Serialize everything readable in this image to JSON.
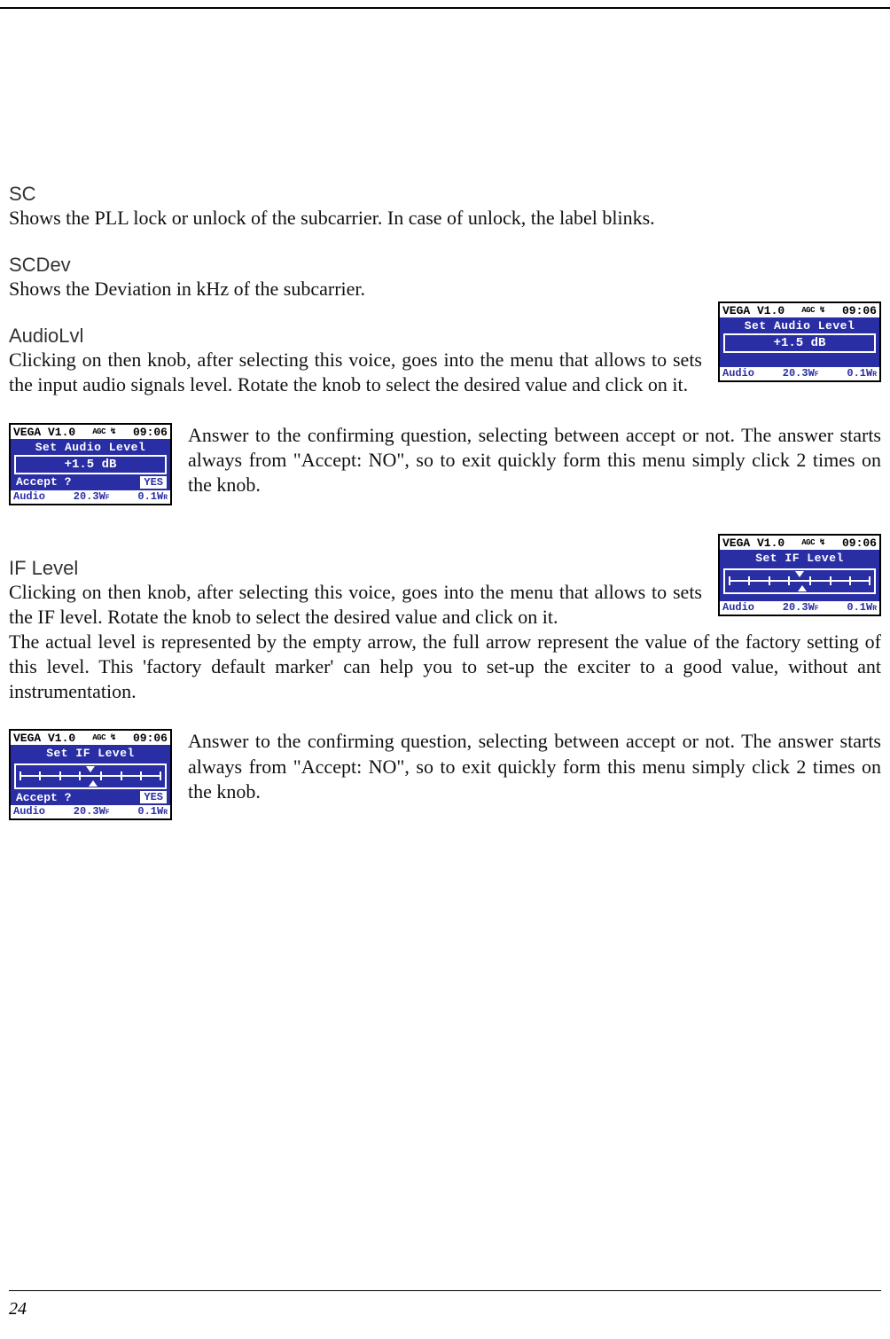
{
  "sections": {
    "sc": {
      "heading": "SC",
      "text": "Shows the PLL lock or unlock of the subcarrier. In case of unlock, the label blinks."
    },
    "scdev": {
      "heading": "SCDev",
      "text": "Shows the Deviation in kHz of the subcarrier."
    },
    "audiolvl": {
      "heading": "AudioLvl",
      "text": "Clicking on then knob, after selecting this voice, goes into the menu that allows to sets the input audio signals level. Rotate the knob to select the desired value and click on it."
    },
    "audiolvl_confirm": {
      "text": "Answer to the confirming question, selecting between accept or not. The answer starts always from \"Accept: NO\", so to exit quickly form this menu simply click 2 times on the knob."
    },
    "iflevel": {
      "heading": "IF Level",
      "text": "Clicking on then knob, after selecting this voice, goes into the menu that allows to sets the IF level. Rotate the knob to select the desired value and click on it.\nThe actual level is represented by the empty arrow, the full arrow represent the value of the factory setting of this level. This 'factory default marker' can help you to set-up the exciter to a good value, without ant instrumentation."
    },
    "iflevel_confirm": {
      "text": "Answer to the confirming question, selecting between accept or not. The answer starts always from \"Accept: NO\", so to exit quickly form this menu simply click 2 times on the knob."
    }
  },
  "lcd": {
    "device": "VEGA V1.0",
    "agc": "AGC ↯",
    "clock": "09:06",
    "audio_title": "Set Audio Level",
    "audio_value": "+1.5 dB",
    "if_title": "Set IF Level",
    "accept_label": "Accept ?",
    "yes": "YES",
    "footer_left": "Audio",
    "footer_mid": "20.3W",
    "footer_mid_sub": "F",
    "footer_right": "0.1W",
    "footer_right_sub": "R"
  },
  "page_number": "24"
}
